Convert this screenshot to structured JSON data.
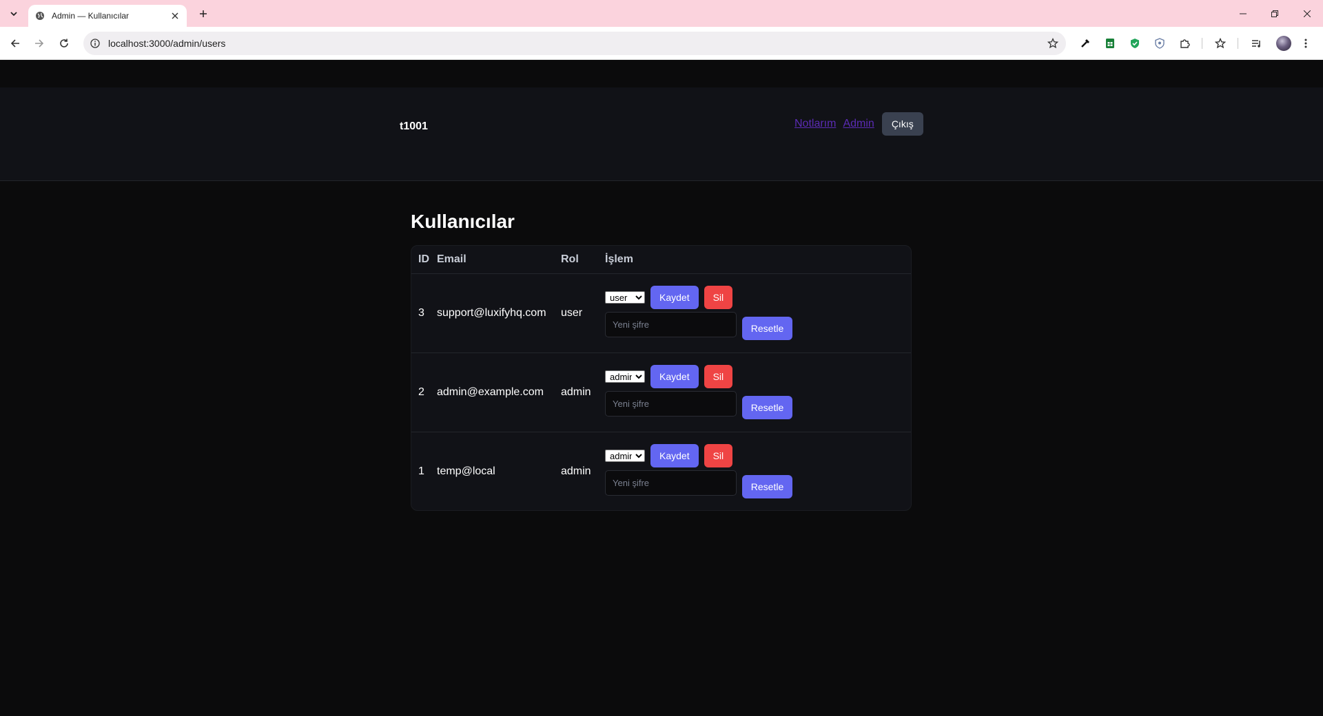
{
  "browser": {
    "tab_title": "Admin — Kullanıcılar",
    "url": "localhost:3000/admin/users"
  },
  "site": {
    "brand": "t1001",
    "nav": {
      "notes": "Notlarım",
      "admin": "Admin",
      "logout": "Çıkış"
    }
  },
  "page": {
    "title": "Kullanıcılar",
    "columns": {
      "id": "ID",
      "email": "Email",
      "role": "Rol",
      "action": "İşlem"
    },
    "save_label": "Kaydet",
    "delete_label": "Sil",
    "reset_label": "Resetle",
    "password_placeholder": "Yeni şifre",
    "users": [
      {
        "id": "3",
        "email": "support@luxifyhq.com",
        "role": "user",
        "selected_role": "user"
      },
      {
        "id": "2",
        "email": "admin@example.com",
        "role": "admin",
        "selected_role": "admin"
      },
      {
        "id": "1",
        "email": "temp@local",
        "role": "admin",
        "selected_role": "admin"
      }
    ]
  },
  "colors": {
    "primary": "#6366f1",
    "danger": "#ef4444",
    "nav_link": "#5b2bb5",
    "background": "#0b0b0c",
    "surface": "#111217"
  }
}
